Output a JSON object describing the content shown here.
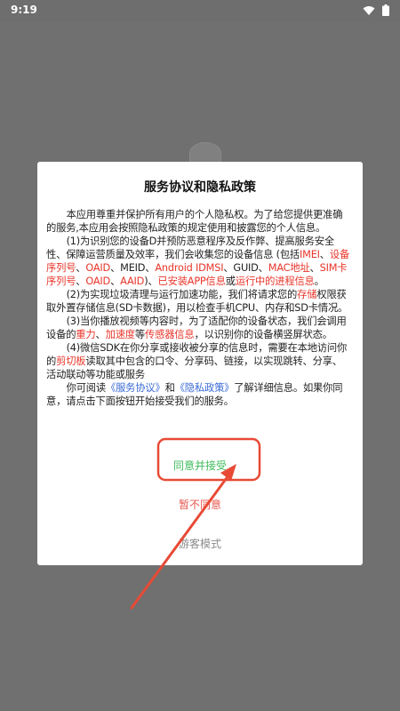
{
  "status_bar": {
    "time": "9:19",
    "icons": [
      "wifi-icon",
      "battery-icon"
    ]
  },
  "dialog": {
    "title": "服务协议和隐私政策",
    "p1": "本应用尊重并保护所有用户的个人隐私权。为了给您提供更准确的服务,本应用会按照隐私政策的规定使用和披露您的个人信息。",
    "p2": {
      "a": "(1)为识别您的设备D并预防恶意程序及反作弊、提高服务安全性、保障运营质量及效率，我们会收集您的设备信息 (包括",
      "imei": "IMEI",
      "sep1": "、",
      "serial": "设备序列号",
      "sep2": "、",
      "oaid": "OAID",
      "sep3": "、MEID、",
      "idmsi": "Android IDMSI",
      "sep4": "、GUID、",
      "mac": "MAC地址",
      "sep5": "、",
      "sim": "SIM卡序列号",
      "sep6": "、",
      "oaid2": "OAID",
      "sep7": "、",
      "aaid": "AAID",
      "sep8": ")、",
      "installed": "已安装APP信息",
      "sep9": "或",
      "running": "运行中的进程信息",
      "end": "。"
    },
    "p3": {
      "a": "(2)为实现垃圾清理与运行加速功能，我们将请求您的",
      "storage": "存储",
      "b": "权限获取外置存储信息(SD卡数据)，用以检查手机CPU、内存和SD卡情况。"
    },
    "p4": {
      "a": "(3)当你播放视频等内容时，为了适配你的设备状态，我们会调用设备的",
      "gravity": "重力",
      "sep1": "、",
      "accel": "加速度",
      "b": "等",
      "sensor": "传感器信息",
      "c": "，以识别你的设备横竖屏状态。"
    },
    "p5": {
      "a": "(4)微信SDK在你分享或接收被分享的信息时，需要在本地访问你的",
      "clipboard": "剪切板",
      "b": "读取其中包含的口令、分享码、链接，以实现跳转、分享、活动联动等功能或服务"
    },
    "p6": {
      "a": "你可阅读",
      "service": "《服务协议》",
      "b": "和",
      "privacy": "《隐私政策》",
      "c": "了解详细信息。如果你同意，请点击下面按钮开始接受我们的服务。"
    },
    "agree": "同意并接受",
    "disagree": "暂不同意",
    "guest": "游客模式"
  },
  "colors": {
    "overlay": "#707070",
    "highlight": "#e8352a",
    "link": "#3a6ad6",
    "agree": "#3dbb5b",
    "disagree": "#e8584f",
    "annotation": "#e84a36"
  }
}
